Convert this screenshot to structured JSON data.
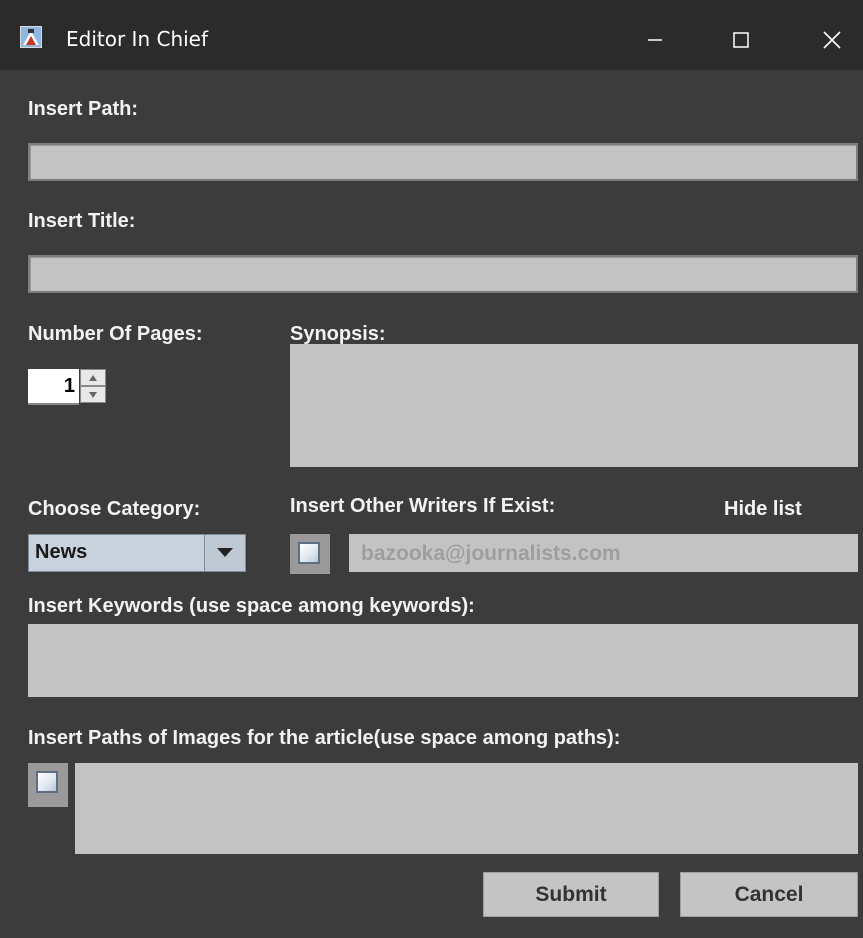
{
  "window": {
    "title": "Editor In Chief"
  },
  "form": {
    "path_label": "Insert Path:",
    "path_value": "",
    "title_label": "Insert Title:",
    "title_value": "",
    "pages_label": "Number Of Pages:",
    "pages_value": "1",
    "synopsis_label": "Synopsis:",
    "synopsis_value": "",
    "category_label": "Choose Category:",
    "category_selected": "News",
    "writers_label": "Insert Other Writers If Exist:",
    "hide_list_label": "Hide list",
    "writers_placeholder": "bazooka@journalists.com",
    "keywords_label": "Insert Keywords (use space among keywords):",
    "keywords_value": "",
    "images_label": "Insert Paths of Images for the article(use space among paths):",
    "images_value": ""
  },
  "buttons": {
    "submit": "Submit",
    "cancel": "Cancel"
  },
  "colors": {
    "background": "#3c3c3c",
    "titlebar": "#2b2b2b",
    "field": "#c3c3c3",
    "label": "#f2f2f2"
  }
}
